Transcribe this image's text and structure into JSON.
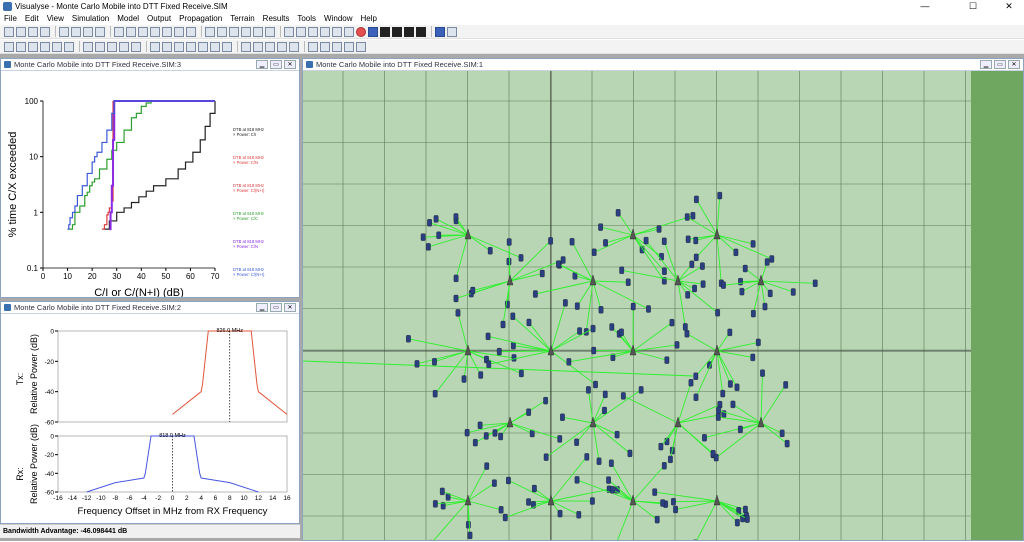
{
  "window": {
    "title": "Visualyse - Monte Carlo Mobile into DTT Fixed Receive.SIM",
    "min": "—",
    "max": "☐",
    "close": "✕"
  },
  "menu": [
    "File",
    "Edit",
    "View",
    "Simulation",
    "Model",
    "Output",
    "Propagation",
    "Terrain",
    "Results",
    "Tools",
    "Window",
    "Help"
  ],
  "toolbar": {
    "zoom_label": "100%"
  },
  "icons": {
    "accent": "#3a6fb0"
  },
  "colors": {
    "map_bg": "#b9d6b4",
    "map_edge": "#6fa660",
    "link": "#2ef02e",
    "mobile": "#2a3f80"
  },
  "plot_window": {
    "title": "Monte Carlo Mobile into DTT Fixed Receive.SIM:3",
    "chart_data": {
      "type": "line",
      "xlabel": "C/I or C/(N+I) (dB)",
      "ylabel": "% time C/X exceeded",
      "xlim": [
        0,
        70
      ],
      "ylim": [
        0.1,
        100
      ],
      "yscale": "log",
      "xticks": [
        "0",
        "10",
        "20",
        "30",
        "40",
        "50",
        "60",
        "70"
      ],
      "yticks": [
        "100",
        "10",
        "1",
        "0.1"
      ],
      "legend": [
        "DTB at 818 MHz × Power: C/I",
        "DTB at 818 MHz × Power: C/N",
        "DTB at 818 MHz × Power: C/(N+I)",
        "DTB at 818 MHz × Power: C/C",
        "DTB at 818 MHz × Power: C/N",
        "DTB at 818 MHz × Power: C/(N+I)"
      ],
      "series": [
        {
          "color": "#222222",
          "x": [
            25,
            27,
            30,
            33,
            36,
            39,
            42,
            45,
            50,
            55,
            58,
            61,
            64,
            66,
            68,
            70
          ],
          "y": [
            0.5,
            0.7,
            1,
            1.2,
            1.5,
            1.9,
            2.4,
            3,
            4,
            6,
            8,
            12,
            20,
            35,
            60,
            100
          ]
        },
        {
          "color": "#e03a3a",
          "x": [
            24,
            25,
            26,
            26.5,
            27,
            28,
            28.5
          ],
          "y": [
            0.5,
            0.6,
            0.9,
            1,
            1.2,
            1.6,
            100
          ]
        },
        {
          "color": "#2e9e2e",
          "x": [
            10,
            10,
            12,
            13,
            15,
            17,
            18,
            19,
            20,
            21,
            23,
            26,
            28,
            30,
            33,
            36,
            38,
            40,
            42,
            44,
            70
          ],
          "y": [
            0.5,
            0.5,
            0.6,
            1,
            1.3,
            2,
            2.3,
            3,
            3.5,
            4,
            6,
            9,
            13,
            18,
            30,
            50,
            60,
            80,
            92,
            100,
            100
          ]
        },
        {
          "color": "#8a2be2",
          "x": [
            27,
            27.5,
            28,
            28.5,
            29,
            70
          ],
          "y": [
            0.5,
            1,
            3,
            20,
            100,
            100
          ]
        },
        {
          "color": "#3a58d8",
          "x": [
            10,
            10.5,
            11,
            12,
            13,
            14,
            16,
            18,
            20,
            21,
            22,
            24,
            26,
            28,
            29,
            70
          ],
          "y": [
            0.5,
            0.6,
            0.8,
            1,
            1.3,
            2,
            3,
            5,
            8,
            10,
            12,
            18,
            30,
            60,
            100,
            100
          ]
        }
      ]
    }
  },
  "spectrum_window": {
    "title": "Monte Carlo Mobile into DTT Fixed Receive.SIM:2",
    "tx_label": "Tx:",
    "rx_label": "Rx:",
    "ylabel": "Relative Power (dB)",
    "xlabel": "Frequency Offset in MHz from RX Frequency",
    "tx_freq_label": "826.0 MHz",
    "rx_freq_label": "818.0 MHz",
    "yticks": [
      "0",
      "-20",
      "-40",
      "-60"
    ],
    "xticks": [
      "-16",
      "-14",
      "-12",
      "-10",
      "-8",
      "-6",
      "-4",
      "-2",
      "0",
      "2",
      "4",
      "6",
      "8",
      "10",
      "12",
      "14",
      "16"
    ],
    "tx_mask": {
      "x": [
        0,
        4,
        4.2,
        5,
        11,
        11.8,
        12,
        16
      ],
      "y": [
        -55,
        -40,
        -35,
        0,
        0,
        -35,
        -40,
        -55
      ]
    },
    "rx_mask": {
      "x": [
        -12,
        -8,
        -4,
        -3.8,
        -3,
        3,
        3.8,
        4,
        8,
        12
      ],
      "y": [
        -60,
        -50,
        -45,
        -40,
        0,
        0,
        -40,
        -45,
        -50,
        -60
      ]
    }
  },
  "status": {
    "text": "Bandwidth Advantage: -46.098441 dB"
  },
  "map_window": {
    "title": "Monte Carlo Mobile into DTT Fixed Receive.SIM:1"
  }
}
